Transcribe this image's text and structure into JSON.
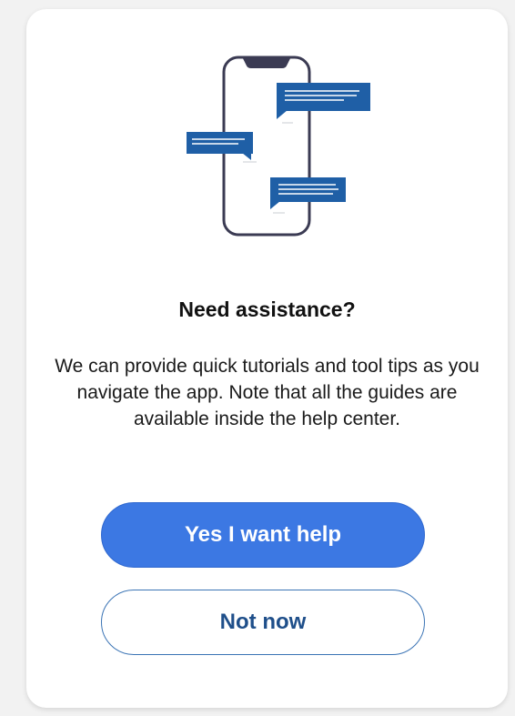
{
  "dialog": {
    "title": "Need assistance?",
    "message": "We can provide quick tutorials and tool tips as you navigate the app. Note that all the guides are available inside the help center.",
    "primary_button_label": "Yes I want help",
    "secondary_button_label": "Not now"
  },
  "illustration": {
    "icon": "phone-chat-illustration",
    "colors": {
      "phone_outline": "#3b3b53",
      "bubble_fill": "#1f5fa6",
      "bubble_lines": "#ffffff"
    }
  },
  "colors": {
    "primary": "#3c78e3",
    "secondary_text": "#1f4f8a",
    "card_bg": "#ffffff"
  }
}
